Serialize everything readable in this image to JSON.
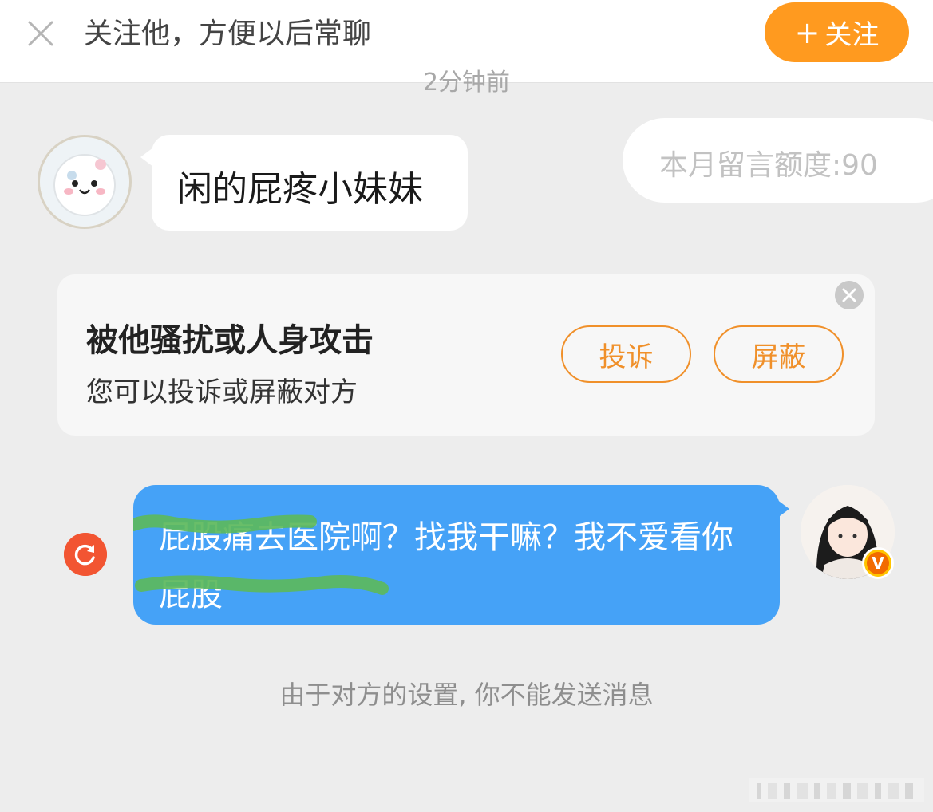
{
  "header": {
    "close_icon": "close-icon",
    "prompt_text": "关注他，方便以后常聊",
    "follow_button": {
      "plus": "+",
      "label": "关注",
      "color": "#ff9a1f"
    }
  },
  "timestamp": "2分钟前",
  "quota": {
    "label": "本月留言额度:90"
  },
  "messages": {
    "incoming": {
      "avatar": "avatar-icon",
      "text": "闲的屁疼小妹妹"
    },
    "outgoing": {
      "text": "屁股痛去医院啊？找我干嘛？我不爱看你屁股",
      "bubble_color": "#45a2f7",
      "status_icon": "retry-icon",
      "verified_badge": "V"
    }
  },
  "report_card": {
    "title": "被他骚扰或人身攻击",
    "subtitle": "您可以投诉或屏蔽对方",
    "complain_label": "投诉",
    "block_label": "屏蔽",
    "accent": "#f0902a"
  },
  "notice": "由于对方的设置, 你不能发送消息"
}
